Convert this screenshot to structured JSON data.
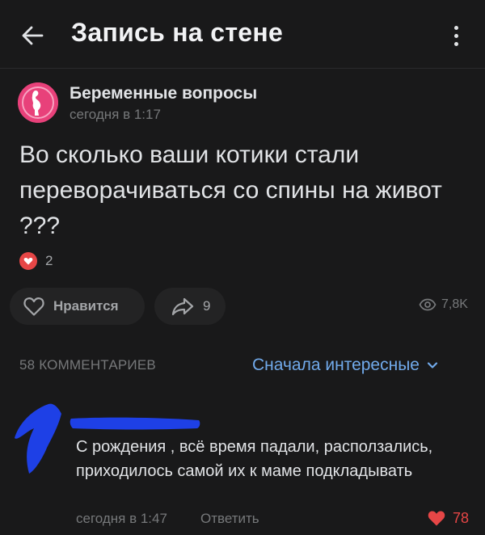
{
  "header": {
    "title": "Запись на стене",
    "back_icon": "arrow-left-icon",
    "more_icon": "more-vertical-icon"
  },
  "post": {
    "group_name": "Беременные вопросы",
    "time": "сегодня в 1:17",
    "text": "Во сколько ваши котики стали переворачиваться со спины на живот ???",
    "reactions_count": "2",
    "like_label": "Нравится",
    "share_count": "9",
    "views_count": "7,8K"
  },
  "comments": {
    "count_label": "58 КОММЕНТАРИЕВ",
    "sort_label": "Сначала интересные",
    "items": [
      {
        "text": "С рождения , всё время падали, расползались, приходилось самой их к маме подкладывать",
        "time": "сегодня в 1:47",
        "reply_label": "Ответить",
        "likes": "78"
      }
    ]
  },
  "colors": {
    "background": "#19191a",
    "accent": "#71aaeb",
    "like_red": "#e64646",
    "scribble_blue": "#1e40e6"
  }
}
